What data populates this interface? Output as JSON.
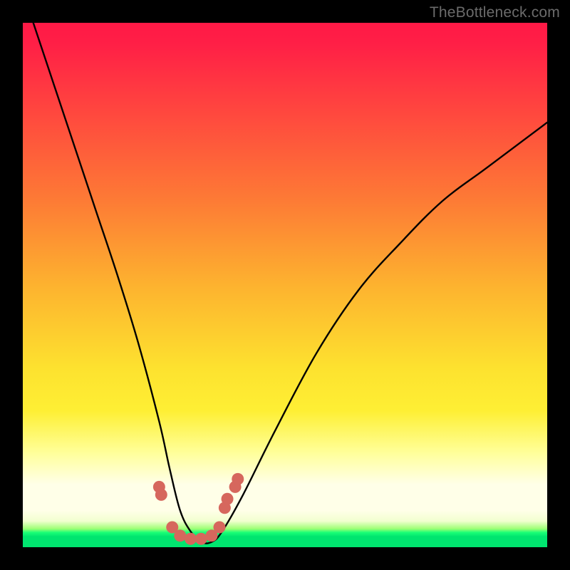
{
  "watermark": "TheBottleneck.com",
  "colors": {
    "frame": "#000000",
    "watermark": "#6b6b6b",
    "curve": "#000000",
    "marker": "#d6675d"
  },
  "chart_data": {
    "type": "line",
    "title": "",
    "xlabel": "",
    "ylabel": "",
    "xlim": [
      0,
      100
    ],
    "ylim": [
      0,
      100
    ],
    "grid": false,
    "legend": false,
    "series": [
      {
        "name": "bottleneck-curve",
        "note": "Estimated percentage curve. x is horizontal position (0=left, 100=right of plot area). y is value (0=bottom, 100=top). Curve descends steeply from upper-left to a minimum near x≈30–35 then rises to the right.",
        "x": [
          2,
          6,
          10,
          14,
          18,
          22,
          26,
          28,
          30,
          32,
          34,
          36,
          38,
          42,
          48,
          56,
          64,
          72,
          80,
          88,
          96,
          100
        ],
        "y": [
          100,
          88,
          76,
          64,
          52,
          39,
          24,
          15,
          7,
          3,
          1,
          1,
          3,
          10,
          22,
          37,
          49,
          58,
          66,
          72,
          78,
          81
        ]
      }
    ],
    "markers": {
      "name": "highlighted-points",
      "note": "Salmon dot clusters near the curve's trough.",
      "points": [
        {
          "x": 26.0,
          "y": 11.5
        },
        {
          "x": 26.4,
          "y": 10.0
        },
        {
          "x": 28.5,
          "y": 3.8
        },
        {
          "x": 30.0,
          "y": 2.2
        },
        {
          "x": 32.0,
          "y": 1.6
        },
        {
          "x": 34.0,
          "y": 1.6
        },
        {
          "x": 36.0,
          "y": 2.2
        },
        {
          "x": 37.5,
          "y": 3.8
        },
        {
          "x": 38.5,
          "y": 7.5
        },
        {
          "x": 39.0,
          "y": 9.2
        },
        {
          "x": 40.5,
          "y": 11.5
        },
        {
          "x": 41.0,
          "y": 13.0
        }
      ]
    }
  }
}
